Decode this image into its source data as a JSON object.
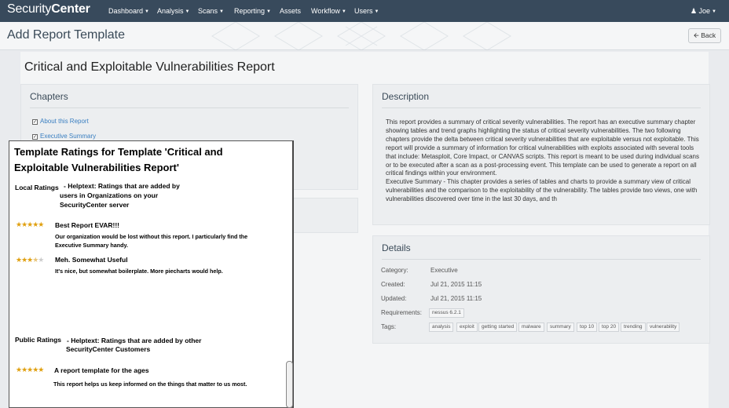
{
  "nav": {
    "brand_a": "Security",
    "brand_b": "Center",
    "items": [
      "Dashboard",
      "Analysis",
      "Scans",
      "Reporting",
      "Assets",
      "Workflow",
      "Users"
    ],
    "user": "Joe"
  },
  "header": {
    "title": "Add Report Template",
    "back_label": "Back"
  },
  "report": {
    "title": "Critical and Exploitable Vulnerabilities Report"
  },
  "chapters": {
    "title": "Chapters",
    "items": [
      "About this Report",
      "Executive Summary"
    ]
  },
  "description": {
    "title": "Description",
    "text": "This report provides a summary of critical severity vulnerabilities. The report has an executive summary chapter showing tables and trend graphs highlighting the status of critical severity vulnerabilities. The two following chapters provide the delta between critical severity vulnerabilities that are exploitable versus not exploitable. This report will provide a summary of information for critical vulnerabilities with exploits associated with several tools that include: Metasploit, Core Impact, or CANVAS scripts. This report is meant to be used during individual scans or to be executed after a scan as a post-processing event. This template can be used to generate a report on all critical findings within your environment.\nExecutive Summary - This chapter provides a series of tables and charts to provide a summary view of critical vulnerabilities and the comparison to the exploitability of the vulnerability. The tables provide two views, one with vulnerabilities discovered over time in the last 30 days, and th"
  },
  "details": {
    "title": "Details",
    "category_label": "Category:",
    "category": "Executive",
    "created_label": "Created:",
    "created": "Jul 21, 2015 11:15",
    "updated_label": "Updated:",
    "updated": "Jul 21, 2015 11:15",
    "requirements_label": "Requirements:",
    "requirements": "nessus 6.2.1",
    "tags_label": "Tags:",
    "tags": [
      "analysis",
      "exploit",
      "getting started",
      "malware",
      "summary",
      "top 10",
      "top 20",
      "trending",
      "vulnerability"
    ]
  },
  "ratings": {
    "title": "Template Ratings for Template 'Critical and Exploitable Vulnerabilities Report'",
    "local_label": "Local Ratings",
    "local_help_1": "- Helptext: Ratings that are added by",
    "local_help_2": "users in Organizations on your",
    "local_help_3": "SecurityCenter server",
    "reviews_local": [
      {
        "stars": 5,
        "title": "Best Report EVAR!!!",
        "body_1": "Our organization would be lost without this report.  I particularly find the",
        "body_2": "Executive Summary handy."
      },
      {
        "stars": 3.5,
        "title": "Meh.  Somewhat Useful",
        "body_1": "It's nice, but somewhat boilerplate.  More piecharts would help.",
        "body_2": ""
      }
    ],
    "public_label": "Public Ratings",
    "public_help_1": "- Helptext: Ratings that are added by other",
    "public_help_2": "SecurityCenter Customers",
    "reviews_public": [
      {
        "stars": 5,
        "title": "A report template for the ages",
        "body_1": "This report helps us keep informed on the things that matter to us most."
      }
    ]
  }
}
